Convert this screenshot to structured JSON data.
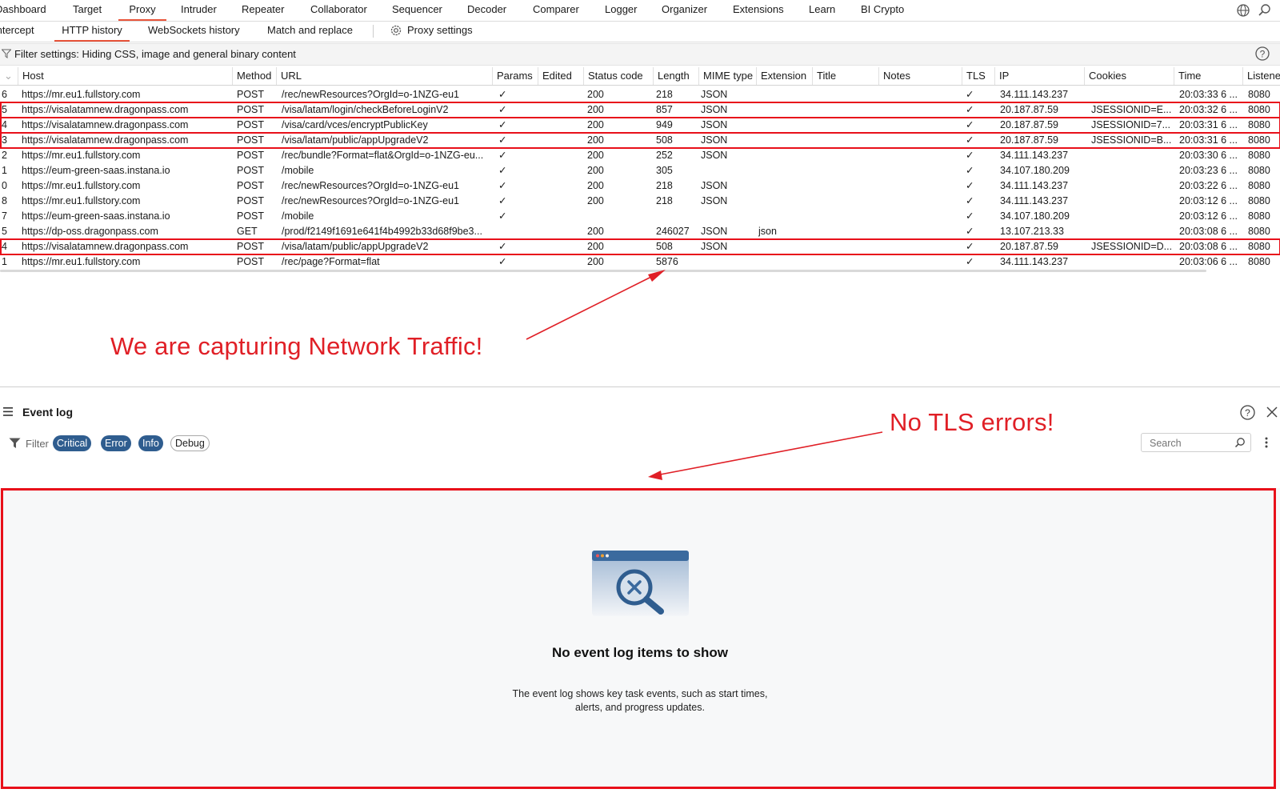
{
  "top_tabs": [
    "Dashboard",
    "Target",
    "Proxy",
    "Intruder",
    "Repeater",
    "Collaborator",
    "Sequencer",
    "Decoder",
    "Comparer",
    "Logger",
    "Organizer",
    "Extensions",
    "Learn",
    "BI Crypto"
  ],
  "sub_tabs": [
    "Intercept",
    "HTTP history",
    "WebSockets history",
    "Match and replace",
    "Proxy settings"
  ],
  "filter_text": "Filter settings: Hiding CSS, image and general binary content",
  "columns": [
    "#",
    "Host",
    "Method",
    "URL",
    "Params",
    "Edited",
    "Status code",
    "Length",
    "MIME type",
    "Extension",
    "Title",
    "Notes",
    "TLS",
    "IP",
    "Cookies",
    "Time",
    "Listener port"
  ],
  "rows": [
    {
      "num": "6",
      "host": "https://mr.eu1.fullstory.com",
      "method": "POST",
      "url": "/rec/newResources?OrgId=o-1NZG-eu1",
      "params": "✓",
      "edited": "",
      "status": "200",
      "length": "218",
      "mime": "JSON",
      "ext": "",
      "title": "",
      "notes": "",
      "tls": "✓",
      "ip": "34.111.143.237",
      "cookies": "",
      "time": "20:03:33 6 ...",
      "port": "8080",
      "highlight": false
    },
    {
      "num": "5",
      "host": "https://visalatamnew.dragonpass.com",
      "method": "POST",
      "url": "/visa/latam/login/checkBeforeLoginV2",
      "params": "✓",
      "edited": "",
      "status": "200",
      "length": "857",
      "mime": "JSON",
      "ext": "",
      "title": "",
      "notes": "",
      "tls": "✓",
      "ip": "20.187.87.59",
      "cookies": "JSESSIONID=E...",
      "time": "20:03:32 6 ...",
      "port": "8080",
      "highlight": true
    },
    {
      "num": "4",
      "host": "https://visalatamnew.dragonpass.com",
      "method": "POST",
      "url": "/visa/card/vces/encryptPublicKey",
      "params": "✓",
      "edited": "",
      "status": "200",
      "length": "949",
      "mime": "JSON",
      "ext": "",
      "title": "",
      "notes": "",
      "tls": "✓",
      "ip": "20.187.87.59",
      "cookies": "JSESSIONID=7...",
      "time": "20:03:31 6 ...",
      "port": "8080",
      "highlight": true
    },
    {
      "num": "3",
      "host": "https://visalatamnew.dragonpass.com",
      "method": "POST",
      "url": "/visa/latam/public/appUpgradeV2",
      "params": "✓",
      "edited": "",
      "status": "200",
      "length": "508",
      "mime": "JSON",
      "ext": "",
      "title": "",
      "notes": "",
      "tls": "✓",
      "ip": "20.187.87.59",
      "cookies": "JSESSIONID=B...",
      "time": "20:03:31 6 ...",
      "port": "8080",
      "highlight": true
    },
    {
      "num": "2",
      "host": "https://mr.eu1.fullstory.com",
      "method": "POST",
      "url": "/rec/bundle?Format=flat&OrgId=o-1NZG-eu...",
      "params": "✓",
      "edited": "",
      "status": "200",
      "length": "252",
      "mime": "JSON",
      "ext": "",
      "title": "",
      "notes": "",
      "tls": "✓",
      "ip": "34.111.143.237",
      "cookies": "",
      "time": "20:03:30 6 ...",
      "port": "8080",
      "highlight": false
    },
    {
      "num": "1",
      "host": "https://eum-green-saas.instana.io",
      "method": "POST",
      "url": "/mobile",
      "params": "✓",
      "edited": "",
      "status": "200",
      "length": "305",
      "mime": "",
      "ext": "",
      "title": "",
      "notes": "",
      "tls": "✓",
      "ip": "34.107.180.209",
      "cookies": "",
      "time": "20:03:23 6 ...",
      "port": "8080",
      "highlight": false
    },
    {
      "num": "0",
      "host": "https://mr.eu1.fullstory.com",
      "method": "POST",
      "url": "/rec/newResources?OrgId=o-1NZG-eu1",
      "params": "✓",
      "edited": "",
      "status": "200",
      "length": "218",
      "mime": "JSON",
      "ext": "",
      "title": "",
      "notes": "",
      "tls": "✓",
      "ip": "34.111.143.237",
      "cookies": "",
      "time": "20:03:22 6 ...",
      "port": "8080",
      "highlight": false
    },
    {
      "num": "8",
      "host": "https://mr.eu1.fullstory.com",
      "method": "POST",
      "url": "/rec/newResources?OrgId=o-1NZG-eu1",
      "params": "✓",
      "edited": "",
      "status": "200",
      "length": "218",
      "mime": "JSON",
      "ext": "",
      "title": "",
      "notes": "",
      "tls": "✓",
      "ip": "34.111.143.237",
      "cookies": "",
      "time": "20:03:12 6 ...",
      "port": "8080",
      "highlight": false
    },
    {
      "num": "7",
      "host": "https://eum-green-saas.instana.io",
      "method": "POST",
      "url": "/mobile",
      "params": "✓",
      "edited": "",
      "status": "",
      "length": "",
      "mime": "",
      "ext": "",
      "title": "",
      "notes": "",
      "tls": "✓",
      "ip": "34.107.180.209",
      "cookies": "",
      "time": "20:03:12 6 ...",
      "port": "8080",
      "highlight": false
    },
    {
      "num": "5",
      "host": "https://dp-oss.dragonpass.com",
      "method": "GET",
      "url": "/prod/f2149f1691e641f4b4992b33d68f9be3...",
      "params": "",
      "edited": "",
      "status": "200",
      "length": "246027",
      "mime": "JSON",
      "ext": "json",
      "title": "",
      "notes": "",
      "tls": "✓",
      "ip": "13.107.213.33",
      "cookies": "",
      "time": "20:03:08 6 ...",
      "port": "8080",
      "highlight": false
    },
    {
      "num": "4",
      "host": "https://visalatamnew.dragonpass.com",
      "method": "POST",
      "url": "/visa/latam/public/appUpgradeV2",
      "params": "✓",
      "edited": "",
      "status": "200",
      "length": "508",
      "mime": "JSON",
      "ext": "",
      "title": "",
      "notes": "",
      "tls": "✓",
      "ip": "20.187.87.59",
      "cookies": "JSESSIONID=D...",
      "time": "20:03:08 6 ...",
      "port": "8080",
      "highlight": true
    },
    {
      "num": "1",
      "host": "https://mr.eu1.fullstory.com",
      "method": "POST",
      "url": "/rec/page?Format=flat",
      "params": "✓",
      "edited": "",
      "status": "200",
      "length": "5876",
      "mime": "",
      "ext": "",
      "title": "",
      "notes": "",
      "tls": "✓",
      "ip": "34.111.143.237",
      "cookies": "",
      "time": "20:03:06 6 ...",
      "port": "8080",
      "highlight": false
    }
  ],
  "annotations": {
    "traffic": "We are capturing Network Traffic!",
    "tls": "No TLS errors!"
  },
  "event_log": {
    "title": "Event log",
    "filter_label": "Filter",
    "chips": [
      "Critical",
      "Error",
      "Info",
      "Debug"
    ],
    "search_placeholder": "Search",
    "empty_title": "No event log items to show",
    "empty_desc_line1": "The event log shows key task events, such as start times,",
    "empty_desc_line2": "alerts, and progress updates."
  },
  "colors": {
    "accent": "#e8543a",
    "annotation": "#e01f26",
    "chip_active": "#2f5d8f",
    "icon_blue": "#3b6a9e"
  }
}
